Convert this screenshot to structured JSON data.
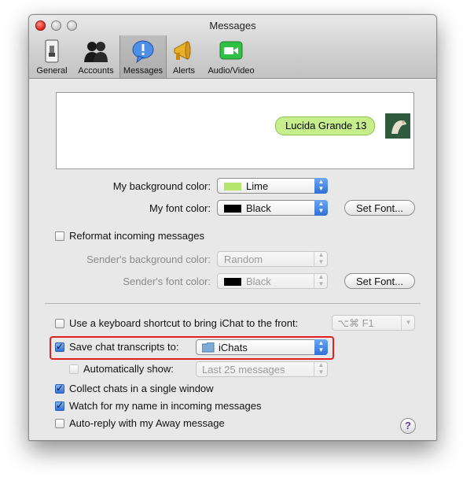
{
  "window": {
    "title": "Messages"
  },
  "toolbar": {
    "tabs": [
      {
        "label": "General",
        "icon": "switch-icon"
      },
      {
        "label": "Accounts",
        "icon": "people-icon"
      },
      {
        "label": "Messages",
        "icon": "message-bubble-icon"
      },
      {
        "label": "Alerts",
        "icon": "megaphone-icon"
      },
      {
        "label": "Audio/Video",
        "icon": "video-camera-icon"
      }
    ],
    "selected": "Messages"
  },
  "preview": {
    "bubble_text": "Lucida Grande 13"
  },
  "my_background": {
    "label": "My background color:",
    "value": "Lime",
    "swatch": "#b6e56e"
  },
  "my_font": {
    "label": "My font color:",
    "value": "Black",
    "swatch": "#000000",
    "button": "Set Font..."
  },
  "reformat": {
    "label": "Reformat incoming messages",
    "checked": false
  },
  "sender_background": {
    "label": "Sender's background color:",
    "value": "Random"
  },
  "sender_font": {
    "label": "Sender's font color:",
    "value": "Black",
    "swatch": "#000000",
    "button": "Set Font..."
  },
  "shortcut": {
    "label": "Use a keyboard shortcut to bring iChat to the front:",
    "value": "⌥⌘ F1",
    "checked": false
  },
  "transcripts": {
    "label": "Save chat transcripts to:",
    "value": "iChats",
    "checked": true
  },
  "auto_show": {
    "label": "Automatically show:",
    "value": "Last 25 messages",
    "checked": false
  },
  "collect": {
    "label": "Collect chats in a single window",
    "checked": true
  },
  "watch": {
    "label": "Watch for my name in incoming messages",
    "checked": true
  },
  "autoreply": {
    "label": "Auto-reply with my Away message",
    "checked": false
  },
  "help": {
    "label": "?"
  },
  "colors": {
    "highlight": "#e02020",
    "accent": "#2f6fd8",
    "bubble": "#c6ef8b"
  }
}
